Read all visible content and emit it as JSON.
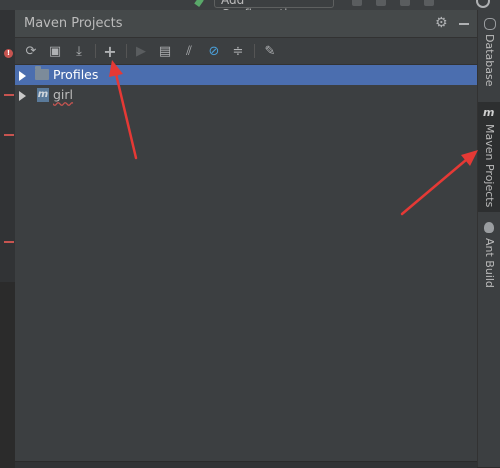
{
  "top_bar": {
    "config_button_label": "Add Configuration...",
    "icons": [
      "build-icon",
      "run-icon",
      "debug-icon",
      "coverage-icon",
      "stop-icon",
      "search-icon"
    ]
  },
  "panel": {
    "title": "Maven Projects",
    "header_icons": [
      "gear-icon",
      "minimize-icon"
    ]
  },
  "toolbar": {
    "buttons": [
      {
        "name": "reimport-icon",
        "glyph": "⟳"
      },
      {
        "name": "generate-sources-icon",
        "glyph": "▣"
      },
      {
        "name": "download-icon",
        "glyph": "⤓"
      },
      {
        "name": "add-icon",
        "glyph": "+"
      },
      {
        "name": "run-icon",
        "glyph": "▶"
      },
      {
        "name": "execute-goal-icon",
        "glyph": "▤"
      },
      {
        "name": "toggle-offline-icon",
        "glyph": "⫽"
      },
      {
        "name": "skip-tests-icon",
        "glyph": "⊘"
      },
      {
        "name": "collapse-all-icon",
        "glyph": "≑"
      },
      {
        "name": "settings-wrench-icon",
        "glyph": "✎"
      }
    ]
  },
  "tree": {
    "items": [
      {
        "label": "Profiles",
        "selected": true,
        "icon": "folder-icon"
      },
      {
        "label": "girl",
        "selected": false,
        "icon": "maven-module-icon"
      }
    ]
  },
  "right_tools": {
    "tabs": [
      {
        "label": "Database",
        "icon": "database-icon",
        "active": false
      },
      {
        "label": "Maven Projects",
        "icon": "maven-icon",
        "active": true
      },
      {
        "label": "Ant Build",
        "icon": "ant-icon",
        "active": false
      }
    ]
  },
  "colors": {
    "selection": "#4b6eaf",
    "annotation_arrow": "#e53935",
    "panel_bg": "#3c3f41"
  }
}
